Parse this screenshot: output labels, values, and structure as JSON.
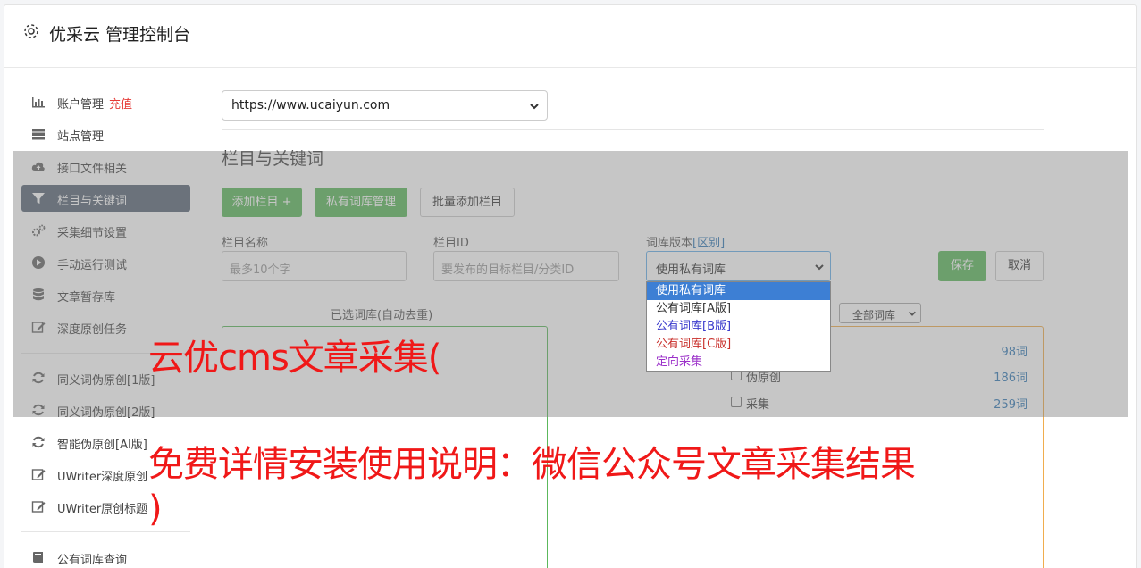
{
  "header": {
    "title": "优采云 管理控制台",
    "icon": "gear-icon"
  },
  "sidebar": {
    "items": [
      {
        "label": "账户管理",
        "badge": "充值",
        "icon": "bar-chart-icon"
      },
      {
        "label": "站点管理",
        "icon": "server-icon"
      },
      {
        "label": "接口文件相关",
        "icon": "cloud-upload-icon"
      },
      {
        "label": "栏目与关键词",
        "icon": "filter-icon",
        "active": true
      },
      {
        "label": "采集细节设置",
        "icon": "gears-icon"
      },
      {
        "label": "手动运行测试",
        "icon": "play-circle-icon"
      },
      {
        "label": "文章暂存库",
        "icon": "database-icon"
      },
      {
        "label": "深度原创任务",
        "icon": "edit-icon"
      },
      {
        "label": "同义词伪原创[1版]",
        "icon": "refresh-icon"
      },
      {
        "label": "同义词伪原创[2版]",
        "icon": "refresh-icon"
      },
      {
        "label": "智能伪原创[AI版]",
        "icon": "refresh-icon"
      },
      {
        "label": "UWriter深度原创",
        "icon": "edit-icon"
      },
      {
        "label": "UWriter原创标题",
        "icon": "edit-icon"
      },
      {
        "label": "公有词库查询",
        "icon": "book-icon"
      }
    ]
  },
  "main": {
    "site_select": {
      "value": "https://www.ucaiyun.com"
    },
    "section_title": "栏目与关键词",
    "buttons": {
      "add_column": "添加栏目 +",
      "private_lib": "私有词库管理",
      "batch_add": "批量添加栏目"
    },
    "form": {
      "name_label": "栏目名称",
      "name_placeholder": "最多10个字",
      "id_label": "栏目ID",
      "id_placeholder": "要发布的目标栏目/分类ID",
      "lib_label": "词库版本",
      "lib_label_link": "[区别]",
      "lib_value": "使用私有词库",
      "save": "保存",
      "cancel": "取消"
    },
    "dropdown_options": [
      {
        "label": "使用私有词库",
        "color": "#ffffff",
        "selected": true
      },
      {
        "label": "公有词库[A版]",
        "color": "#333333"
      },
      {
        "label": "公有词库[B版]",
        "color": "#3a3acc"
      },
      {
        "label": "公有词库[C版]",
        "color": "#c9302c"
      },
      {
        "label": "定向采集",
        "color": "#9b30c9"
      }
    ],
    "selected_lib_label": "已选词库(自动去重)",
    "all_lib_select": "全部词库",
    "libraries": [
      {
        "name": "",
        "count": "98词"
      },
      {
        "name": "伪原创",
        "count": "186词"
      },
      {
        "name": "采集",
        "count": "259词"
      }
    ]
  },
  "watermark": {
    "line1": "云优cms文章采集(",
    "line2": "免费详情安装使用说明：微信公众号文章采集结果",
    "line3": ")"
  }
}
